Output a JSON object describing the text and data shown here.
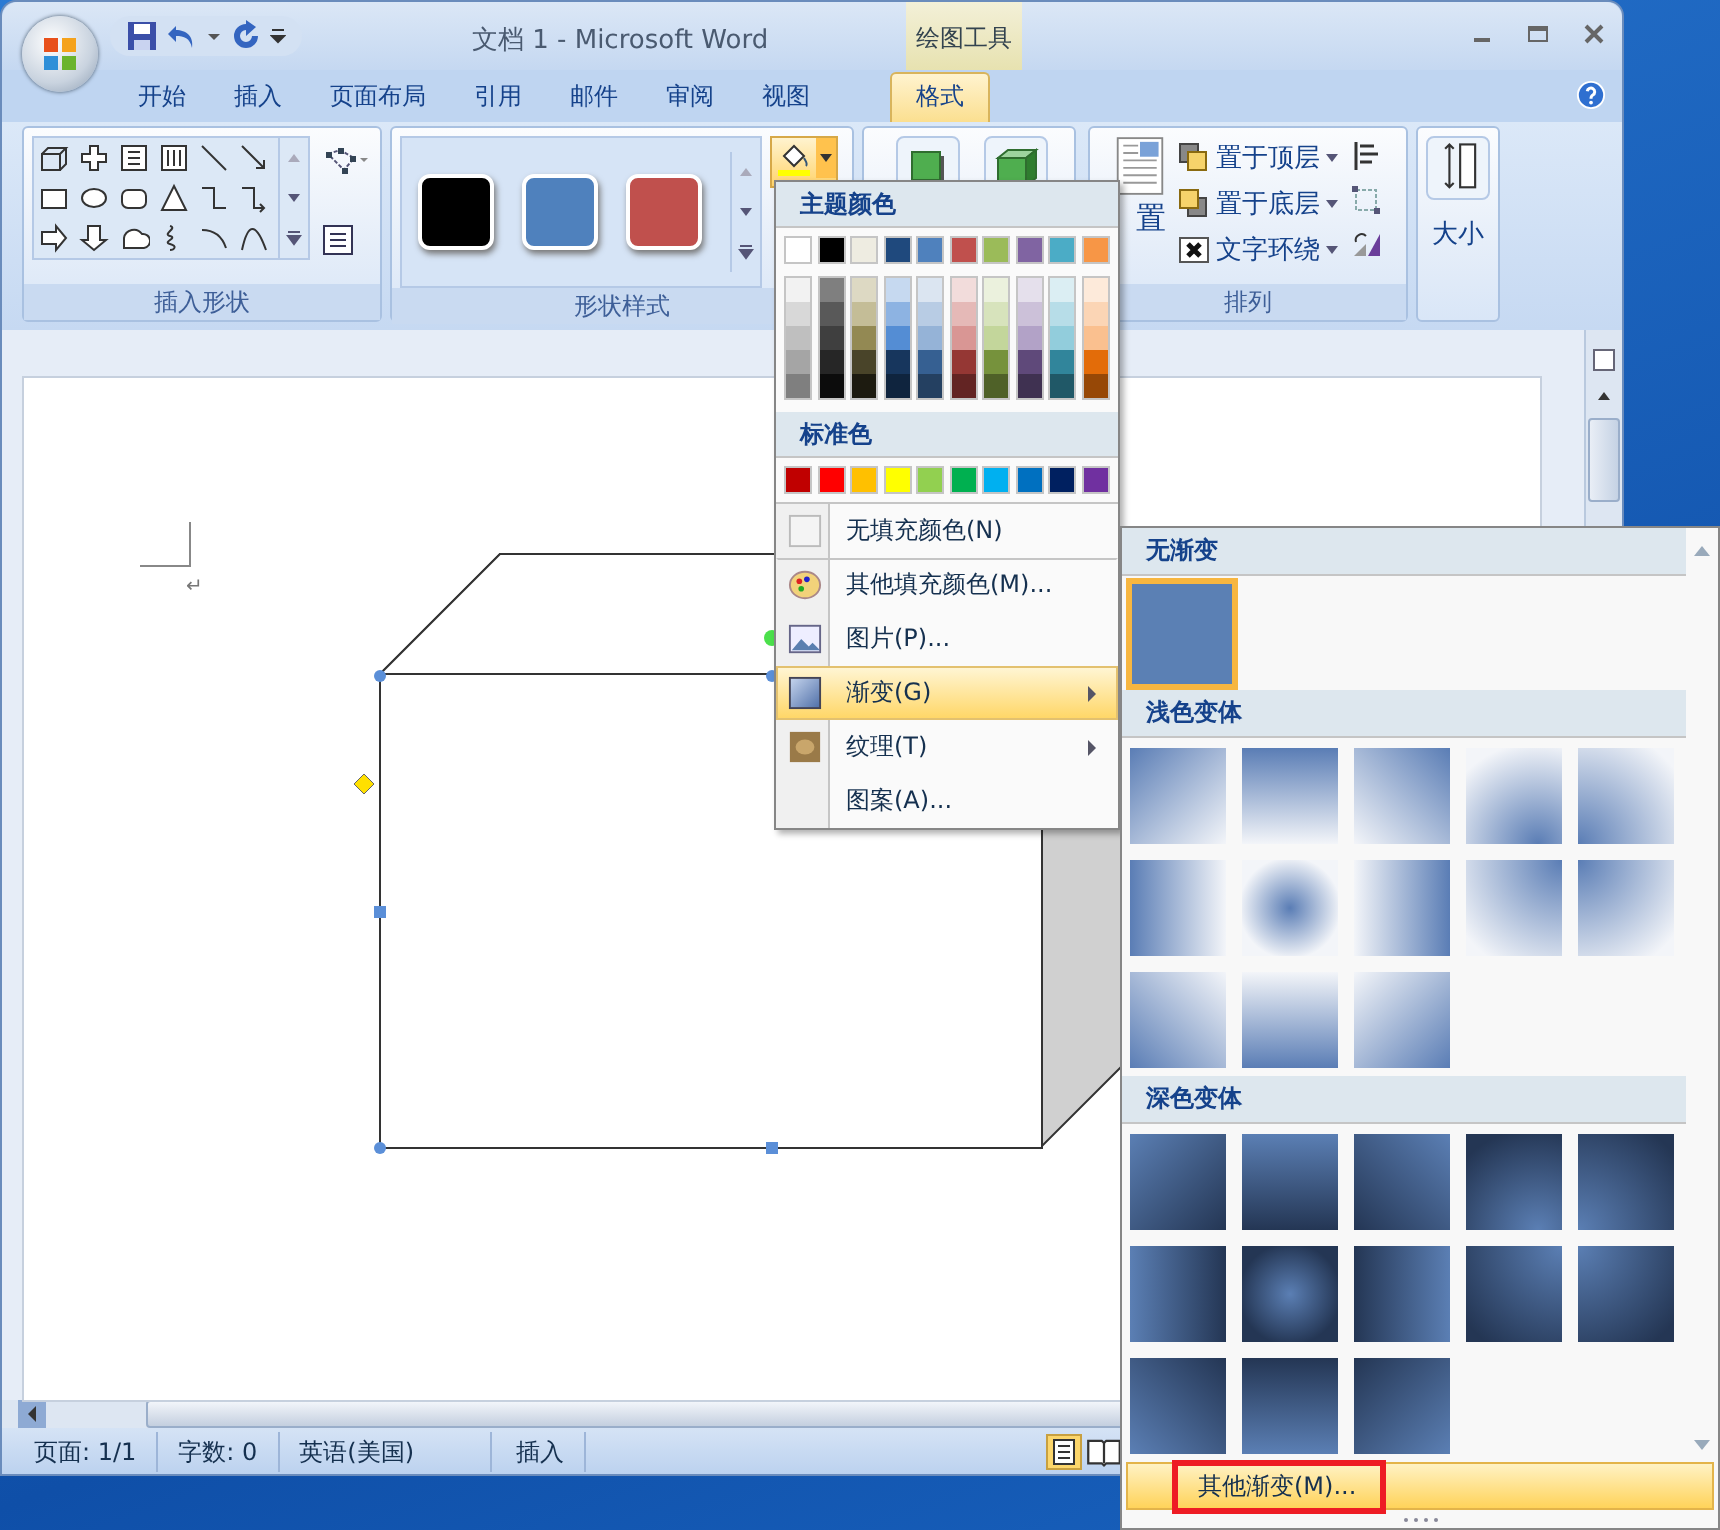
{
  "window": {
    "title": "文档 1 - Microsoft Word",
    "context_group": "绘图工具"
  },
  "ribbon_tabs": [
    {
      "label": "开始",
      "selected": false
    },
    {
      "label": "插入",
      "selected": false
    },
    {
      "label": "页面布局",
      "selected": false
    },
    {
      "label": "引用",
      "selected": false
    },
    {
      "label": "邮件",
      "selected": false
    },
    {
      "label": "审阅",
      "selected": false
    },
    {
      "label": "视图",
      "selected": false
    },
    {
      "label": "格式",
      "selected": true
    }
  ],
  "groups": {
    "insert_shapes": "插入形状",
    "shape_styles": "形状样式",
    "arrange": "排列"
  },
  "style_swatches": [
    {
      "color": "#000000"
    },
    {
      "color": "#4f81bd"
    },
    {
      "color": "#c0504d"
    }
  ],
  "arrange_buttons": [
    "置于顶层",
    "置于底层",
    "文字环绕"
  ],
  "position_button": "置",
  "size_button": "大小",
  "paragraph_mark": "↵",
  "fill_menu": {
    "theme_title": "主题颜色",
    "theme_colors": [
      {
        "color": "#ffffff"
      },
      {
        "color": "#000000"
      },
      {
        "color": "#eeece1"
      },
      {
        "color": "#1f497d"
      },
      {
        "color": "#4f81bd"
      },
      {
        "color": "#c0504d"
      },
      {
        "color": "#9bbb59"
      },
      {
        "color": "#8064a2"
      },
      {
        "color": "#4bacc6"
      },
      {
        "color": "#f79646"
      }
    ],
    "shade_columns": [
      {
        "shades": [
          {
            "color": "#f2f2f2"
          },
          {
            "color": "#d8d8d8"
          },
          {
            "color": "#bfbfbf"
          },
          {
            "color": "#a5a5a5"
          },
          {
            "color": "#7f7f7f"
          }
        ]
      },
      {
        "shades": [
          {
            "color": "#7f7f7f"
          },
          {
            "color": "#595959"
          },
          {
            "color": "#3f3f3f"
          },
          {
            "color": "#262626"
          },
          {
            "color": "#0c0c0c"
          }
        ]
      },
      {
        "shades": [
          {
            "color": "#ddd9c3"
          },
          {
            "color": "#c4bd97"
          },
          {
            "color": "#938953"
          },
          {
            "color": "#494429"
          },
          {
            "color": "#1d1b10"
          }
        ]
      },
      {
        "shades": [
          {
            "color": "#c6d9f0"
          },
          {
            "color": "#8db3e2"
          },
          {
            "color": "#548dd4"
          },
          {
            "color": "#17365d"
          },
          {
            "color": "#0f243e"
          }
        ]
      },
      {
        "shades": [
          {
            "color": "#dbe5f1"
          },
          {
            "color": "#b8cce4"
          },
          {
            "color": "#95b3d7"
          },
          {
            "color": "#366092"
          },
          {
            "color": "#244061"
          }
        ]
      },
      {
        "shades": [
          {
            "color": "#f2dcdb"
          },
          {
            "color": "#e5b9b7"
          },
          {
            "color": "#d99694"
          },
          {
            "color": "#953734"
          },
          {
            "color": "#632423"
          }
        ]
      },
      {
        "shades": [
          {
            "color": "#ebf1dd"
          },
          {
            "color": "#d7e3bc"
          },
          {
            "color": "#c3d69b"
          },
          {
            "color": "#76923c"
          },
          {
            "color": "#4f6128"
          }
        ]
      },
      {
        "shades": [
          {
            "color": "#e5e0ec"
          },
          {
            "color": "#ccc1d9"
          },
          {
            "color": "#b2a2c7"
          },
          {
            "color": "#5f497a"
          },
          {
            "color": "#3f3151"
          }
        ]
      },
      {
        "shades": [
          {
            "color": "#dbeef3"
          },
          {
            "color": "#b7dde8"
          },
          {
            "color": "#92cddc"
          },
          {
            "color": "#31859b"
          },
          {
            "color": "#205867"
          }
        ]
      },
      {
        "shades": [
          {
            "color": "#fdeada"
          },
          {
            "color": "#fbd5b5"
          },
          {
            "color": "#fac08f"
          },
          {
            "color": "#e36c09"
          },
          {
            "color": "#974806"
          }
        ]
      }
    ],
    "standard_title": "标准色",
    "standard_colors": [
      {
        "color": "#c00000"
      },
      {
        "color": "#ff0000"
      },
      {
        "color": "#ffc000"
      },
      {
        "color": "#ffff00"
      },
      {
        "color": "#92d050"
      },
      {
        "color": "#00b050"
      },
      {
        "color": "#00b0f0"
      },
      {
        "color": "#0070c0"
      },
      {
        "color": "#002060"
      },
      {
        "color": "#7030a0"
      }
    ],
    "items": [
      {
        "label": "无填充颜色(N)",
        "kind": "no-fill",
        "selected": false,
        "submenu": false
      },
      {
        "label": "其他填充颜色(M)...",
        "kind": "more-colors",
        "selected": false,
        "submenu": false
      },
      {
        "label": "图片(P)...",
        "kind": "picture",
        "selected": false,
        "submenu": false
      },
      {
        "label": "渐变(G)",
        "kind": "gradient",
        "selected": true,
        "submenu": true
      },
      {
        "label": "纹理(T)",
        "kind": "texture",
        "selected": false,
        "submenu": true
      },
      {
        "label": "图案(A)...",
        "kind": "pattern",
        "selected": false,
        "submenu": false
      }
    ]
  },
  "gradient_panel": {
    "sections": [
      {
        "title": "无渐变",
        "kind": "none",
        "swatches": [
          {
            "kind": "solid",
            "selected": true
          }
        ]
      },
      {
        "title": "浅色变体",
        "kind": "light",
        "swatches": [
          {
            "kind": "diagonal-top-left",
            "selected": false
          },
          {
            "kind": "top",
            "selected": false
          },
          {
            "kind": "diagonal-top-right",
            "selected": false
          },
          {
            "kind": "radial-bottom",
            "selected": false
          },
          {
            "kind": "radial-bottom-left",
            "selected": false
          },
          {
            "kind": "left",
            "selected": false
          },
          {
            "kind": "center",
            "selected": false
          },
          {
            "kind": "right",
            "selected": false
          },
          {
            "kind": "radial-top-right",
            "selected": false
          },
          {
            "kind": "radial-top-left",
            "selected": false
          },
          {
            "kind": "diagonal-bottom-left",
            "selected": false
          },
          {
            "kind": "bottom",
            "selected": false
          },
          {
            "kind": "diagonal-bottom-right",
            "selected": false
          }
        ]
      },
      {
        "title": "深色变体",
        "kind": "dark",
        "swatches": [
          {
            "kind": "diagonal-top-left",
            "selected": false
          },
          {
            "kind": "top",
            "selected": false
          },
          {
            "kind": "diagonal-top-right",
            "selected": false
          },
          {
            "kind": "radial-bottom",
            "selected": false
          },
          {
            "kind": "radial-bottom-left",
            "selected": false
          },
          {
            "kind": "left",
            "selected": false
          },
          {
            "kind": "center",
            "selected": false
          },
          {
            "kind": "right",
            "selected": false
          },
          {
            "kind": "radial-top-right",
            "selected": false
          },
          {
            "kind": "radial-top-left",
            "selected": false
          },
          {
            "kind": "diagonal-bottom-left",
            "selected": false
          },
          {
            "kind": "bottom",
            "selected": false
          },
          {
            "kind": "diagonal-bottom-right",
            "selected": false
          }
        ]
      }
    ],
    "more_label": "其他渐变(M)...",
    "more_highlighted": true
  },
  "status_bar": [
    "页面: 1/1",
    "字数: 0",
    "英语(美国)",
    "插入"
  ]
}
